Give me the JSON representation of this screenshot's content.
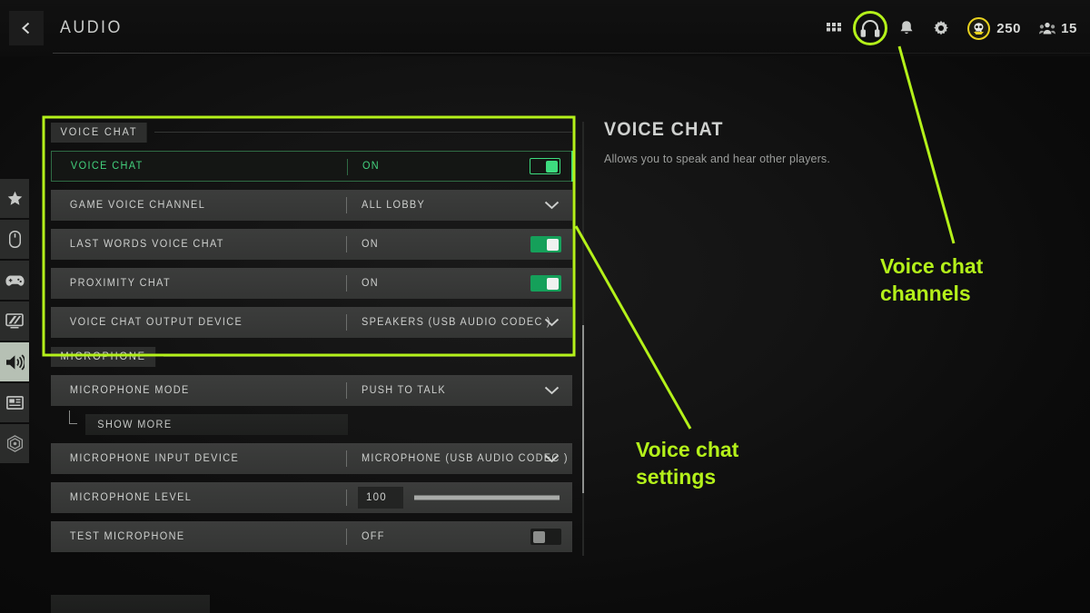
{
  "header": {
    "back_icon": "chevron-left-icon",
    "title": "AUDIO"
  },
  "top_icons": [
    {
      "name": "grid-menu-icon",
      "label": "Grid Menu"
    },
    {
      "name": "headset-icon",
      "label": "Headset",
      "highlighted": true
    },
    {
      "name": "bell-icon",
      "label": "Notifications"
    },
    {
      "name": "gear-icon",
      "label": "Settings"
    }
  ],
  "currency": {
    "icon": "skull-badge-icon",
    "amount": "250"
  },
  "players": {
    "icon": "squad-icon",
    "count": "15"
  },
  "sidebar": {
    "items": [
      {
        "name": "sidebar-item-general",
        "icon": "star-icon",
        "active": false
      },
      {
        "name": "sidebar-item-mouse",
        "icon": "mouse-icon",
        "active": false
      },
      {
        "name": "sidebar-item-controller",
        "icon": "controller-icon",
        "active": false
      },
      {
        "name": "sidebar-item-graphics",
        "icon": "monitor-icon",
        "active": false
      },
      {
        "name": "sidebar-item-audio",
        "icon": "speaker-icon",
        "active": true
      },
      {
        "name": "sidebar-item-interface",
        "icon": "layout-icon",
        "active": false
      },
      {
        "name": "sidebar-item-accessibility",
        "icon": "radar-icon",
        "active": false
      }
    ]
  },
  "settings": {
    "sections": [
      {
        "title": "VOICE CHAT",
        "rows": [
          {
            "label": "VOICE CHAT",
            "value": "ON",
            "control": "toggle-on-outline",
            "selected": true
          },
          {
            "label": "GAME VOICE CHANNEL",
            "value": "ALL LOBBY",
            "control": "dropdown",
            "selected": false
          },
          {
            "label": "LAST WORDS VOICE CHAT",
            "value": "ON",
            "control": "toggle-on",
            "selected": false
          },
          {
            "label": "PROXIMITY CHAT",
            "value": "ON",
            "control": "toggle-on",
            "selected": false
          },
          {
            "label": "VOICE CHAT OUTPUT DEVICE",
            "value": "SPEAKERS (USB AUDIO CODEC )",
            "control": "dropdown",
            "selected": false
          }
        ]
      },
      {
        "title": "MICROPHONE",
        "rows": [
          {
            "label": "MICROPHONE MODE",
            "value": "PUSH TO TALK",
            "control": "dropdown",
            "selected": false
          },
          {
            "label": "SHOW MORE",
            "control": "sub-button",
            "selected": false
          },
          {
            "label": "MICROPHONE INPUT DEVICE",
            "value": "MICROPHONE (USB AUDIO CODEC )",
            "control": "dropdown",
            "selected": false
          },
          {
            "label": "MICROPHONE LEVEL",
            "value": "100",
            "control": "slider",
            "fill_percent": 100,
            "selected": false
          },
          {
            "label": "TEST MICROPHONE",
            "value": "OFF",
            "control": "toggle-off",
            "selected": false
          }
        ]
      }
    ]
  },
  "detail": {
    "title": "VOICE CHAT",
    "description": "Allows you to speak and hear other players."
  },
  "annotations": [
    {
      "name": "annotation-voice-chat-channels",
      "text": "Voice chat\nchannels"
    },
    {
      "name": "annotation-voice-chat-settings",
      "text": "Voice chat\nsettings"
    }
  ],
  "colors": {
    "annotation_green": "#b4f11a",
    "accent_green": "#3ddc7f",
    "toggle_green": "#15a05a",
    "currency_gold": "#e8d21e"
  }
}
